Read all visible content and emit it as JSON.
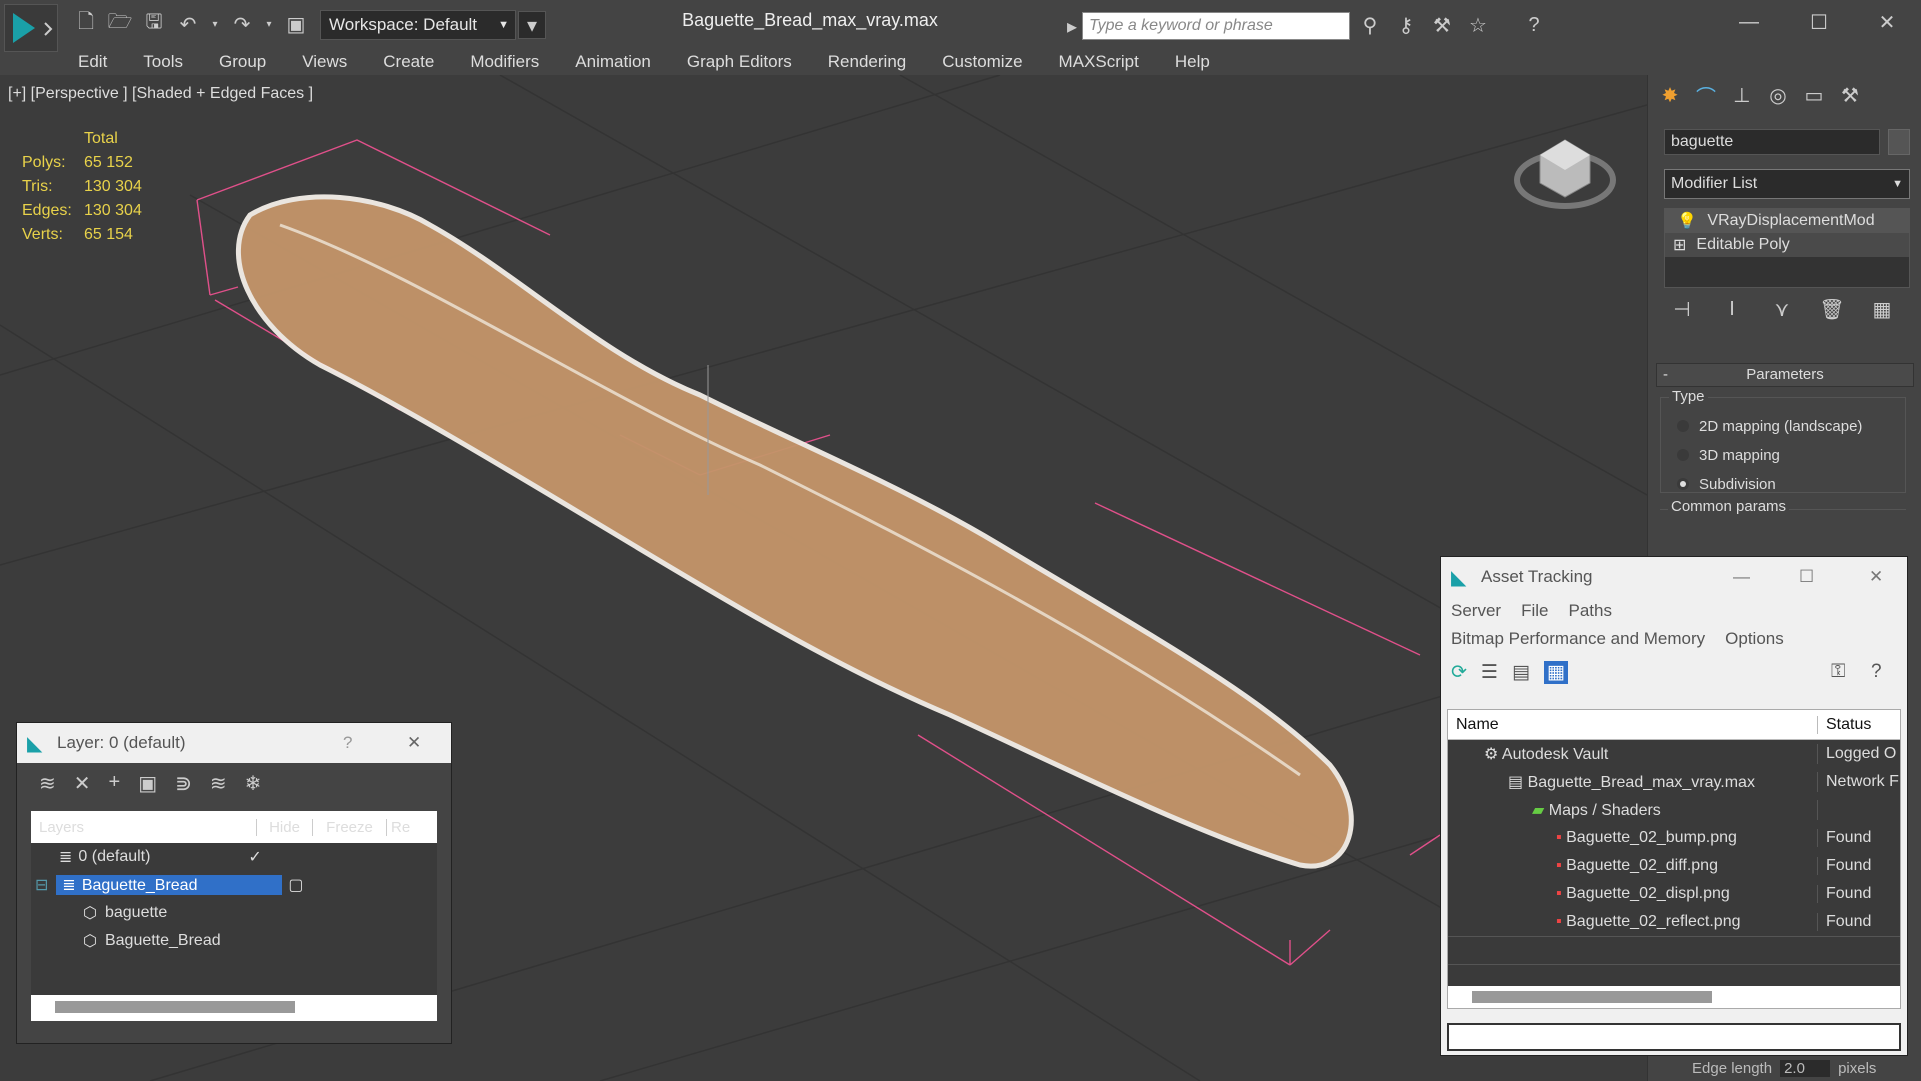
{
  "window": {
    "title": "Baguette_Bread_max_vray.max",
    "workspace": "Workspace: Default",
    "search_placeholder": "Type a keyword or phrase"
  },
  "menu": [
    "Edit",
    "Tools",
    "Group",
    "Views",
    "Create",
    "Modifiers",
    "Animation",
    "Graph Editors",
    "Rendering",
    "Customize",
    "MAXScript",
    "Help"
  ],
  "viewport": {
    "label": "[+] [Perspective ] [Shaded + Edged Faces ]",
    "stats": {
      "header": "Total",
      "rows": [
        {
          "k": "Polys:",
          "v": "65 152"
        },
        {
          "k": "Tris:",
          "v": "130 304"
        },
        {
          "k": "Edges:",
          "v": "130 304"
        },
        {
          "k": "Verts:",
          "v": "65 154"
        }
      ]
    }
  },
  "cmd": {
    "object_name": "baguette",
    "modifier_list": "Modifier List",
    "stack": [
      "VRayDisplacementMod",
      "Editable Poly"
    ],
    "rollout": "Parameters",
    "type_label": "Type",
    "options": [
      "2D mapping (landscape)",
      "3D mapping",
      "Subdivision"
    ],
    "selected_option": "Subdivision",
    "common": "Common params",
    "edge_length_label": "Edge length",
    "edge_length_value": "2.0",
    "pixels": "pixels"
  },
  "layer": {
    "title": "Layer: 0 (default)",
    "help": "?",
    "cols": [
      "Layers",
      "Hide",
      "Freeze",
      "Re"
    ],
    "rows": [
      "0 (default)",
      "Baguette_Bread",
      "baguette",
      "Baguette_Bread"
    ]
  },
  "asset": {
    "title": "Asset Tracking",
    "menu1": [
      "Server",
      "File",
      "Paths"
    ],
    "menu2": [
      "Bitmap Performance and Memory",
      "Options"
    ],
    "cols": [
      "Name",
      "Status"
    ],
    "rows": [
      {
        "n": "Autodesk Vault",
        "s": "Logged O"
      },
      {
        "n": "Baguette_Bread_max_vray.max",
        "s": "Network F"
      },
      {
        "n": "Maps / Shaders",
        "s": ""
      },
      {
        "n": "Baguette_02_bump.png",
        "s": "Found"
      },
      {
        "n": "Baguette_02_diff.png",
        "s": "Found"
      },
      {
        "n": "Baguette_02_displ.png",
        "s": "Found"
      },
      {
        "n": "Baguette_02_reflect.png",
        "s": "Found"
      }
    ]
  }
}
